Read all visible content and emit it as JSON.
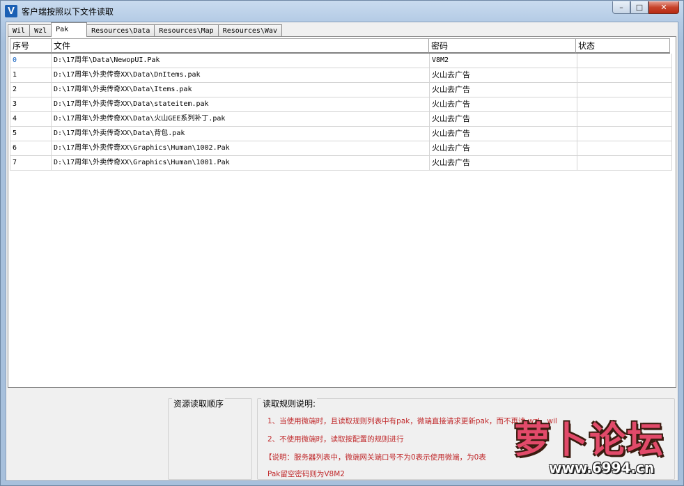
{
  "window": {
    "title": "客户端按照以下文件读取"
  },
  "title_buttons": {
    "minimize": "–",
    "maximize": "□",
    "close": "✕"
  },
  "tabs": [
    {
      "label": "Wil"
    },
    {
      "label": "Wzl"
    },
    {
      "label": "Pak",
      "active": true
    },
    {
      "label": "Resources\\Data"
    },
    {
      "label": "Resources\\Map"
    },
    {
      "label": "Resources\\Wav"
    }
  ],
  "grid": {
    "columns": [
      "序号",
      "文件",
      "密码",
      "状态"
    ],
    "rows": [
      {
        "index": "0",
        "file": "D:\\17周年\\Data\\NewopUI.Pak",
        "password": "V8M2",
        "status": ""
      },
      {
        "index": "1",
        "file": "D:\\17周年\\外卖传奇XX\\Data\\DnItems.pak",
        "password": "火山去广告",
        "status": ""
      },
      {
        "index": "2",
        "file": "D:\\17周年\\外卖传奇XX\\Data\\Items.pak",
        "password": "火山去广告",
        "status": ""
      },
      {
        "index": "3",
        "file": "D:\\17周年\\外卖传奇XX\\Data\\stateitem.pak",
        "password": "火山去广告",
        "status": ""
      },
      {
        "index": "4",
        "file": "D:\\17周年\\外卖传奇XX\\Data\\火山GEE系列补丁.pak",
        "password": "火山去广告",
        "status": ""
      },
      {
        "index": "5",
        "file": "D:\\17周年\\外卖传奇XX\\Data\\背包.pak",
        "password": "火山去广告",
        "status": ""
      },
      {
        "index": "6",
        "file": "D:\\17周年\\外卖传奇XX\\Graphics\\Human\\1002.Pak",
        "password": "火山去广告",
        "status": ""
      },
      {
        "index": "7",
        "file": "D:\\17周年\\外卖传奇XX\\Graphics\\Human\\1001.Pak",
        "password": "火山去广告",
        "status": ""
      }
    ]
  },
  "resource_order": {
    "label": "资源读取顺序"
  },
  "rules": {
    "label": "读取规则说明:",
    "line1": "1、当使用微端时，且读取规则列表中有pak，微端直接请求更新pak，而不再读 wzl，wil",
    "line2": "2、不使用微端时，读取按配置的规则进行",
    "line3": "【说明：服务器列表中，微端网关端口号不为0表示使用微端，为0表",
    "line4": "Pak留空密码则为V8M2"
  },
  "watermark": {
    "text": "萝卜论坛",
    "url": "www.6994.cn"
  },
  "colors": {
    "rule_text": "#c0292b",
    "title_gradient": "#b4cbe5",
    "selected_text": "#1060c0"
  }
}
